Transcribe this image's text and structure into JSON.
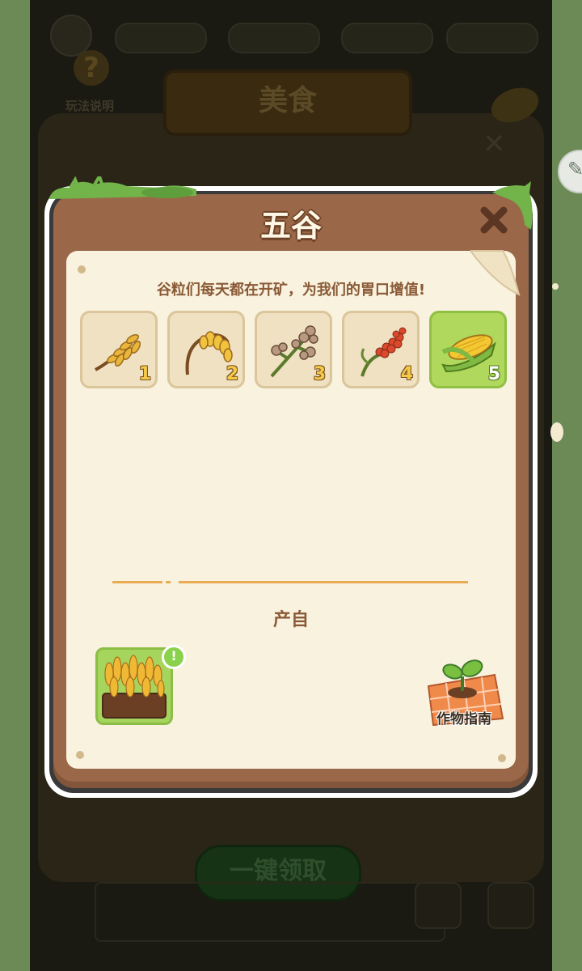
{
  "background": {
    "help_label": "玩法说明",
    "banner_title": "美食",
    "claim_all_label": "一键领取"
  },
  "modal": {
    "title": "五谷",
    "description": "谷粒们每天都在开矿，为我们的胃口增值!",
    "tiles": [
      {
        "num": "1",
        "icon": "wheat-icon",
        "active": false
      },
      {
        "num": "2",
        "icon": "millet-icon",
        "active": false
      },
      {
        "num": "3",
        "icon": "buckwheat-icon",
        "active": false
      },
      {
        "num": "4",
        "icon": "sorghum-icon",
        "active": false
      },
      {
        "num": "5",
        "icon": "corn-icon",
        "active": true
      }
    ],
    "source_label": "产自",
    "source_badge": "!",
    "guide_label": "作物指南"
  },
  "colors": {
    "wood": "#9a6848",
    "paper": "#f8f2df",
    "active_tile": "#b0d85d",
    "text_brown": "#8a5a36"
  }
}
